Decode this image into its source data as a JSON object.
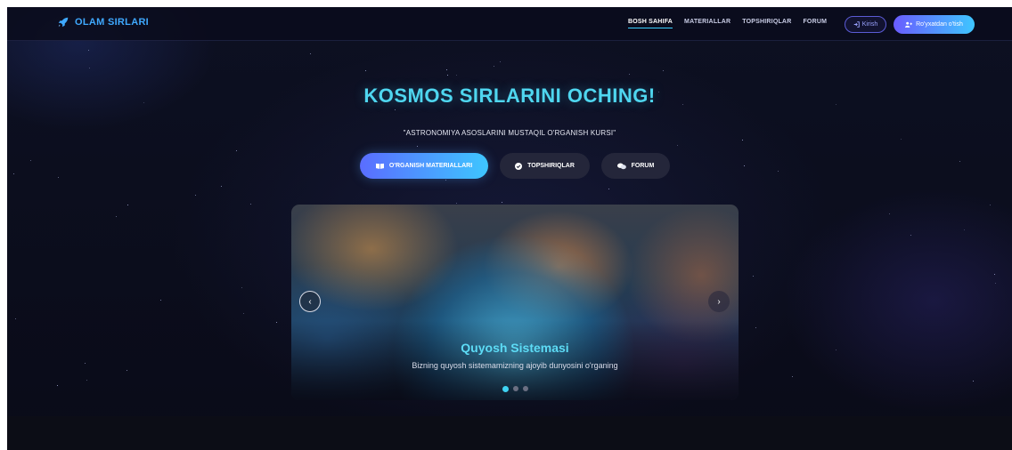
{
  "brand": {
    "name": "OLAM SIRLARI",
    "icon": "rocket-icon",
    "color": "#3fa9ff"
  },
  "nav": {
    "links": [
      {
        "label": "BOSH SAHIFA",
        "active": true
      },
      {
        "label": "MATERIALLAR",
        "active": false
      },
      {
        "label": "TOPSHIRIQLAR",
        "active": false
      },
      {
        "label": "FORUM",
        "active": false
      }
    ],
    "login_label": "Kirish",
    "register_label": "Ro'yxatdan o'tish"
  },
  "hero": {
    "title": "KOSMOS SIRLARINI OCHING!",
    "subtitle": "\"ASTRONOMIYA ASOSLARINI MUSTAQIL O'RGANISH KURSI\"",
    "buttons": {
      "materials": "O'RGANISH MATERIALLARI",
      "tasks": "TOPSHIRIQLAR",
      "forum": "FORUM"
    }
  },
  "carousel": {
    "slide_title": "Quyosh Sistemasi",
    "slide_text": "Bizning quyosh sistemamizning ajoyib dunyosini o'rganing",
    "total_slides": 3,
    "active_slide": 1
  },
  "colors": {
    "accent_cyan": "#3fd3f2",
    "accent_purple": "#6a5cff",
    "background": "#0d1022"
  }
}
